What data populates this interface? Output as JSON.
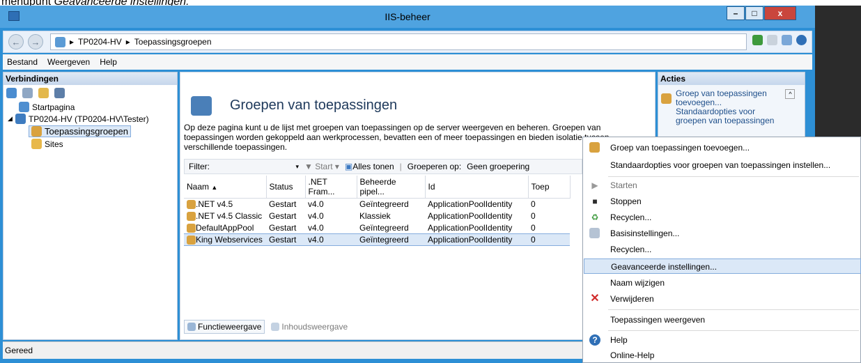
{
  "caption": {
    "prefix": "menupunt ",
    "italic": "Geavanceerde instellingen."
  },
  "window": {
    "title": "IIS-beheer",
    "minimize": "–",
    "maximize": "□",
    "close": "x"
  },
  "address": {
    "crumbs": [
      "TP0204-HV",
      "Toepassingsgroepen"
    ],
    "sep": "▸"
  },
  "menu": [
    "Bestand",
    "Weergeven",
    "Help"
  ],
  "connections": {
    "title": "Verbindingen",
    "items": [
      {
        "label": "Startpagina"
      },
      {
        "label": "TP0204-HV (TP0204-HV\\Tester)"
      },
      {
        "label": "Toepassingsgroepen"
      },
      {
        "label": "Sites"
      }
    ]
  },
  "main": {
    "title": "Groepen van toepassingen",
    "desc1": "Op deze pagina kunt u de lijst met groepen van toepassingen op de server weergeven en beheren. Groepen van",
    "desc2": "toepassingen worden gekoppeld aan werkprocessen, bevatten een of meer toepassingen en bieden isolatie tussen",
    "desc3": "verschillende toepassingen.",
    "filter": {
      "label": "Filter:",
      "start": "Start",
      "showall": "Alles tonen",
      "group_label": "Groeperen op:",
      "group_value": "Geen groepering"
    },
    "columns": [
      "Naam",
      "Status",
      ".NET Fram...",
      "Beheerde pipel...",
      "Id",
      "Toep"
    ],
    "rows": [
      {
        "name": ".NET v4.5",
        "status": "Gestart",
        "net": "v4.0",
        "pipeline": "Geïntegreerd",
        "id": "ApplicationPoolIdentity",
        "apps": "0"
      },
      {
        "name": ".NET v4.5 Classic",
        "status": "Gestart",
        "net": "v4.0",
        "pipeline": "Klassiek",
        "id": "ApplicationPoolIdentity",
        "apps": "0"
      },
      {
        "name": "DefaultAppPool",
        "status": "Gestart",
        "net": "v4.0",
        "pipeline": "Geïntegreerd",
        "id": "ApplicationPoolIdentity",
        "apps": "0"
      },
      {
        "name": "King Webservices",
        "status": "Gestart",
        "net": "v4.0",
        "pipeline": "Geïntegreerd",
        "id": "ApplicationPoolIdentity",
        "apps": "0"
      }
    ],
    "tabs": {
      "features": "Functieweergave",
      "content": "Inhoudsweergave"
    }
  },
  "actions": {
    "title": "Acties",
    "link1a": "Groep van toepassingen",
    "link1b": "toevoegen...",
    "link2a": "Standaardopties voor",
    "link2b": "groepen van toepassingen"
  },
  "context_menu": {
    "add": "Groep van toepassingen toevoegen...",
    "defaults": "Standaardopties voor groepen van toepassingen instellen...",
    "start": "Starten",
    "stop": "Stoppen",
    "recycle": "Recyclen...",
    "basic": "Basisinstellingen...",
    "recycle2": "Recyclen...",
    "advanced": "Geavanceerde instellingen...",
    "rename": "Naam wijzigen",
    "delete": "Verwijderen",
    "viewapps": "Toepassingen weergeven",
    "help": "Help",
    "onlinehelp": "Online-Help"
  },
  "status": "Gereed",
  "colors": {
    "accent": "#2d8fd5",
    "close": "#c9463d",
    "selection": "#dbe8f7"
  }
}
